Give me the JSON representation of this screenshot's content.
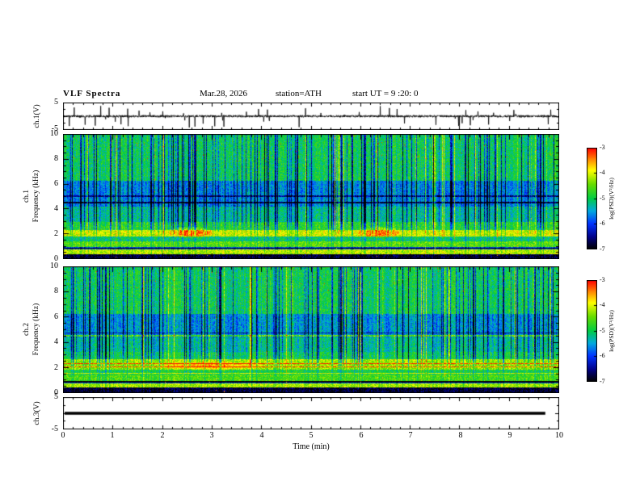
{
  "header": {
    "title": "VLF  Spectra",
    "date": "Mar.28, 2026",
    "station": "station=ATH",
    "start_ut": "start UT =  9 :20: 0"
  },
  "left_labels": {
    "ch1_wave": "ch.1(V)",
    "ch1_channel": "ch.1",
    "ch2_channel": "ch.2",
    "freq_label": "Frequency (kHz)",
    "ch3_wave": "ch.3(V)"
  },
  "yaxis": {
    "wave_top": "5",
    "wave_bottom": "-5",
    "spec_ticks": [
      "10",
      "8",
      "6",
      "4",
      "2",
      "0"
    ]
  },
  "xaxis": {
    "label": "Time  (min)",
    "ticks": [
      "0",
      "1",
      "2",
      "3",
      "4",
      "5",
      "6",
      "7",
      "8",
      "9",
      "10"
    ]
  },
  "colorbar": {
    "unit": "log(PSD)(V²/Hz)",
    "ticks": [
      "-3",
      "-4",
      "-5",
      "-6",
      "-7"
    ],
    "stops": [
      [
        0.0,
        "#000000"
      ],
      [
        0.12,
        "#000088"
      ],
      [
        0.25,
        "#0033ff"
      ],
      [
        0.38,
        "#00aadd"
      ],
      [
        0.5,
        "#00cc44"
      ],
      [
        0.64,
        "#66dd00"
      ],
      [
        0.78,
        "#ffff00"
      ],
      [
        0.9,
        "#ff7700"
      ],
      [
        1.0,
        "#ff0000"
      ]
    ]
  },
  "chart_data": [
    {
      "type": "line",
      "title": "ch.1(V) broadband VLF time series",
      "xlabel": "Time (min)",
      "xlim": [
        0,
        10
      ],
      "ylabel": "ch.1(V)",
      "ylim": [
        -5,
        5
      ],
      "description": "Low-amplitude noise around 0 V with dense impulsive sferic spikes up to about ±4 V throughout the 10-minute record",
      "seed": 11,
      "n": 2000,
      "noise_amp": 0.4,
      "spike_prob": 0.03,
      "spike_amp": 4.2
    },
    {
      "type": "heatmap",
      "title": "ch.1 VLF spectrogram",
      "xlabel": "Time (min)",
      "xlim": [
        0,
        10
      ],
      "ylabel": "Frequency (kHz)",
      "ylim": [
        0,
        10
      ],
      "zlabel": "log(PSD)(V²/Hz)",
      "zlim": [
        -7,
        -3
      ],
      "description": "Green background PSD near 1e-5 V²/Hz; dense vertical blue dropouts 3-6 kHz; bright yellow-green bands below 2.5 kHz; black band below 0.5 kHz; dark interference lines near 4.5 and 5 kHz; sparse red sferic pixels above 8 kHz; orange patches near 2 kHz around 2.5 and 6.4 min",
      "seed": 21,
      "bands": [
        [
          0,
          0.045,
          0.05
        ],
        [
          0.045,
          0.08,
          0.72
        ],
        [
          0.08,
          0.1,
          0.28
        ],
        [
          0.1,
          0.145,
          0.62
        ],
        [
          0.145,
          0.185,
          0.48
        ],
        [
          0.185,
          0.235,
          0.74
        ],
        [
          0.235,
          0.3,
          0.55
        ],
        [
          0.3,
          0.42,
          0.44
        ],
        [
          0.42,
          0.63,
          0.34
        ],
        [
          0.63,
          1.01,
          0.5
        ]
      ],
      "mod_weight": [
        [
          0,
          0.15
        ],
        [
          0.18,
          0.25
        ],
        [
          0.3,
          0.9
        ],
        [
          0.5,
          1.0
        ],
        [
          0.65,
          0.9
        ],
        [
          1,
          0.75
        ]
      ],
      "lines": [
        {
          "f": 0.455,
          "d": -0.3,
          "w": 0.005
        },
        {
          "f": 0.505,
          "d": -0.22,
          "w": 0.005
        },
        {
          "f": 0.09,
          "d": -0.35,
          "w": 0.006
        }
      ],
      "blobs": [
        {
          "x": 0.255,
          "f": 0.215,
          "rx": 0.055,
          "rf": 0.05,
          "d": 0.22
        },
        {
          "x": 0.635,
          "f": 0.215,
          "rx": 0.05,
          "rf": 0.05,
          "d": 0.2
        }
      ],
      "streak_dip_prob": 0.2,
      "streak_bright_prob": 0.05,
      "red_speckle_prob": 0.004
    },
    {
      "type": "heatmap",
      "title": "ch.2 VLF spectrogram",
      "xlabel": "Time (min)",
      "xlim": [
        0,
        10
      ],
      "ylabel": "Frequency (kHz)",
      "ylim": [
        0,
        10
      ],
      "zlabel": "log(PSD)(V²/Hz)",
      "zlim": [
        -7,
        -3
      ],
      "description": "Similar to ch.1 but with stronger horizontal yellow-orange interference stripes between 1.5 and 3 kHz and near 4.5 kHz; vertical blue dropouts 3-6 kHz; black band below 0.5 kHz",
      "seed": 42,
      "bands": [
        [
          0,
          0.045,
          0.05
        ],
        [
          0.045,
          0.08,
          0.7
        ],
        [
          0.08,
          0.1,
          0.3
        ],
        [
          0.1,
          0.15,
          0.6
        ],
        [
          0.15,
          0.19,
          0.52
        ],
        [
          0.19,
          0.26,
          0.68
        ],
        [
          0.26,
          0.33,
          0.5
        ],
        [
          0.33,
          0.44,
          0.44
        ],
        [
          0.44,
          0.63,
          0.36
        ],
        [
          0.63,
          1.01,
          0.5
        ]
      ],
      "mod_weight": [
        [
          0,
          0.15
        ],
        [
          0.18,
          0.25
        ],
        [
          0.3,
          0.9
        ],
        [
          0.5,
          1.0
        ],
        [
          0.65,
          0.9
        ],
        [
          1,
          0.75
        ]
      ],
      "lines": [
        {
          "f": 0.16,
          "d": 0.22,
          "w": 0.004
        },
        {
          "f": 0.21,
          "d": 0.25,
          "w": 0.006
        },
        {
          "f": 0.235,
          "d": 0.3,
          "w": 0.005
        },
        {
          "f": 0.265,
          "d": 0.2,
          "w": 0.005
        },
        {
          "f": 0.455,
          "d": 0.25,
          "w": 0.005
        },
        {
          "f": 0.09,
          "d": -0.35,
          "w": 0.006
        },
        {
          "f": 0.48,
          "d": -0.2,
          "w": 0.004
        }
      ],
      "blobs": [
        {
          "x": 0.3,
          "f": 0.22,
          "rx": 0.12,
          "rf": 0.04,
          "d": 0.18
        }
      ],
      "streak_dip_prob": 0.2,
      "streak_bright_prob": 0.05,
      "red_speckle_prob": 0.003
    },
    {
      "type": "line",
      "title": "ch.3(V) time series",
      "xlabel": "Time (min)",
      "xlim": [
        0,
        10
      ],
      "ylabel": "ch.3(V)",
      "ylim": [
        -5,
        5
      ],
      "description": "Flat saturated trace at 0 V (thick black line) ending near 9.75 min",
      "seed": 7,
      "flat": true,
      "flat_end": 0.972
    }
  ]
}
